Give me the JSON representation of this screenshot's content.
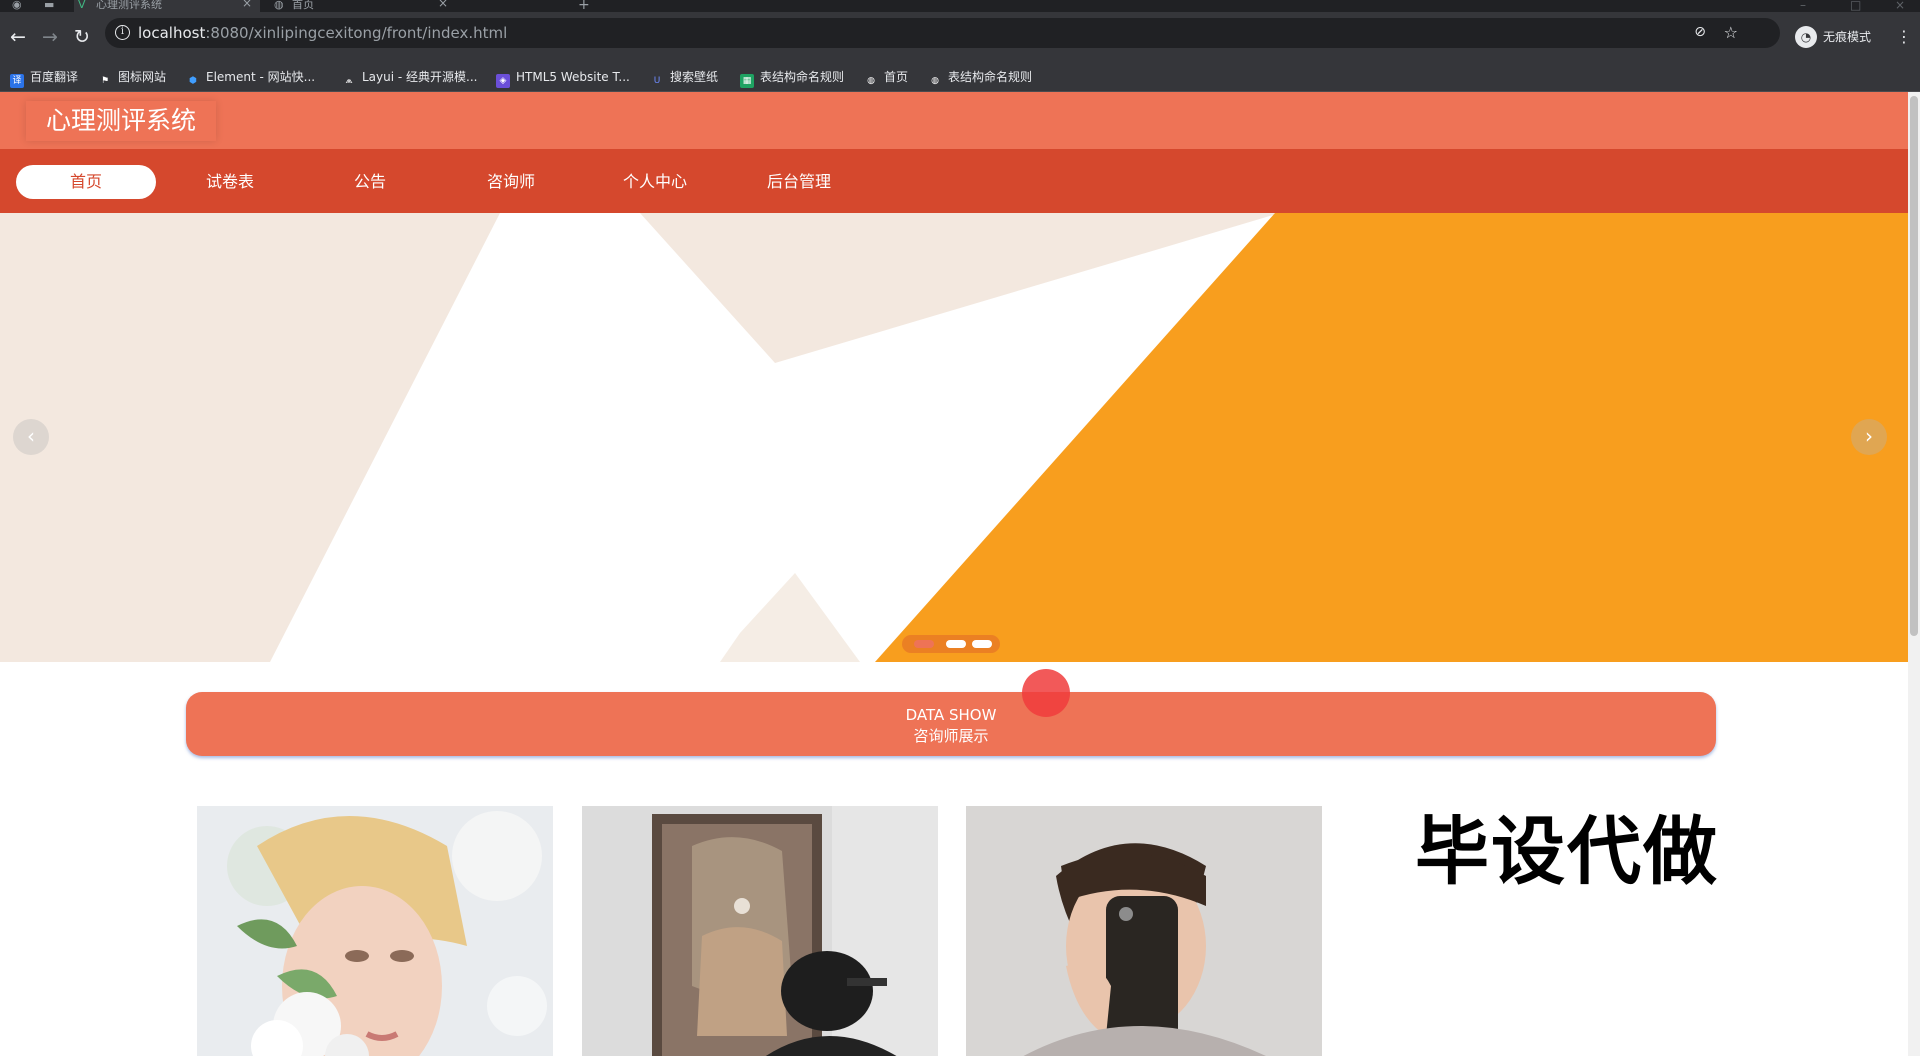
{
  "browser": {
    "tabs": [
      {
        "title": "心理测评系统"
      },
      {
        "title": "首页"
      }
    ],
    "new_tab": "+",
    "back": "←",
    "forward": "→",
    "reload": "↻",
    "url_host": "localhost",
    "url_rest": ":8080/xinlipingcexitong/front/index.html",
    "incognito_label": "无痕模式",
    "menu": "⋮",
    "bookmarks": [
      {
        "label": "百度翻译",
        "icon": "baidu-translate-icon",
        "color": "#2b73e8"
      },
      {
        "label": "图标网站",
        "icon": "flag-icon",
        "color": "#35363a"
      },
      {
        "label": "Element - 网站快...",
        "icon": "element-icon",
        "color": "#409eff"
      },
      {
        "label": "Layui - 经典开源模...",
        "icon": "layui-icon",
        "color": "#35363a"
      },
      {
        "label": "HTML5 Website T...",
        "icon": "html5-template-icon",
        "color": "#6b4fd8"
      },
      {
        "label": "搜索壁纸",
        "icon": "wallpaper-icon",
        "color": "#3b5bdb"
      },
      {
        "label": "表结构命名规则",
        "icon": "sheet-icon",
        "color": "#1ea362"
      },
      {
        "label": "首页",
        "icon": "globe-icon",
        "color": "#35363a"
      },
      {
        "label": "表结构命名规则",
        "icon": "globe-icon",
        "color": "#35363a"
      }
    ]
  },
  "site": {
    "title": "心理测评系统",
    "nav": [
      {
        "label": "首页",
        "active": true
      },
      {
        "label": "试卷表"
      },
      {
        "label": "公告"
      },
      {
        "label": "咨询师"
      },
      {
        "label": "个人中心"
      },
      {
        "label": "后台管理"
      }
    ],
    "carousel": {
      "prev": "‹",
      "next": "›",
      "slide_count": 3,
      "active_slide": 1
    },
    "section": {
      "title_en": "DATA SHOW",
      "title_zh": "咨询师展示"
    },
    "watermark": "毕设代做"
  },
  "colors": {
    "header": "#ee7356",
    "nav": "#d5482d",
    "banner_orange": "#f89e1e",
    "banner_cream": "#f3e8df"
  }
}
